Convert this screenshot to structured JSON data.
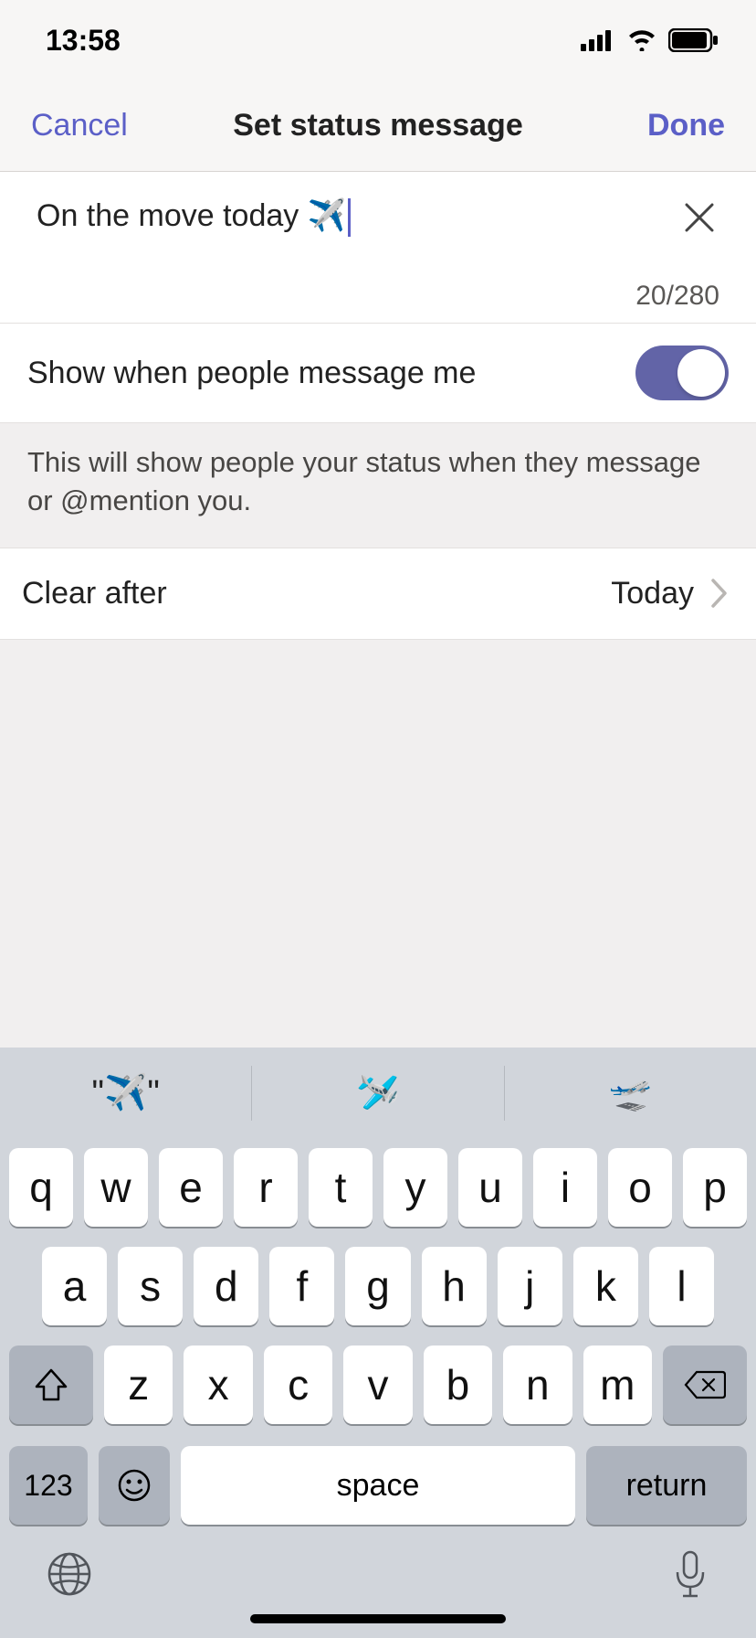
{
  "status_bar": {
    "time": "13:58"
  },
  "nav": {
    "cancel": "Cancel",
    "title": "Set status message",
    "done": "Done"
  },
  "status_input": {
    "text": "On the move today ✈️",
    "count": "20/280"
  },
  "toggle": {
    "label": "Show when people message me",
    "on": true,
    "helper": "This will show people your status when they message or @mention you."
  },
  "clear": {
    "label": "Clear after",
    "value": "Today"
  },
  "keyboard": {
    "suggestions": [
      "\"✈️\"",
      "🛩️",
      "🛫"
    ],
    "row1": [
      "q",
      "w",
      "e",
      "r",
      "t",
      "y",
      "u",
      "i",
      "o",
      "p"
    ],
    "row2": [
      "a",
      "s",
      "d",
      "f",
      "g",
      "h",
      "j",
      "k",
      "l"
    ],
    "row3": [
      "z",
      "x",
      "c",
      "v",
      "b",
      "n",
      "m"
    ],
    "numeric": "123",
    "space": "space",
    "return": "return"
  }
}
